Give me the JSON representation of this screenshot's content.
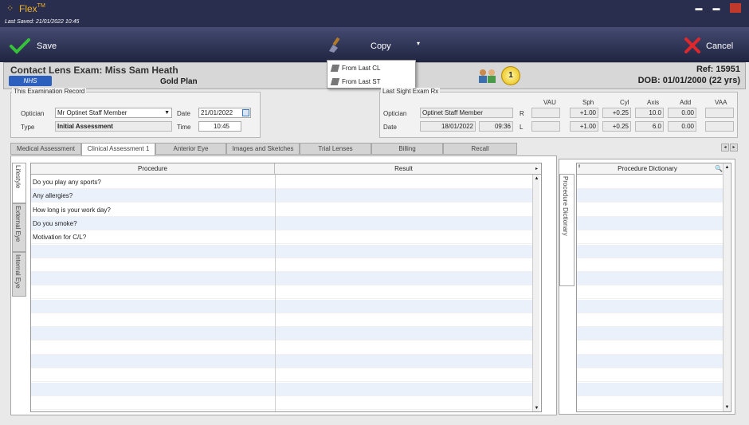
{
  "window": {
    "app_name": "Flex",
    "trademark": "TM",
    "minimize": "▬",
    "maximize": "▬"
  },
  "last_saved": "Last Saved: 21/01/2022 10:45",
  "toolbar": {
    "save_label": "Save",
    "copy_label": "Copy",
    "cancel_label": "Cancel",
    "copy_arrow": "▾"
  },
  "copy_menu": {
    "items": [
      "From Last CL",
      "From Last ST"
    ]
  },
  "patient": {
    "title": "Contact Lens Exam: Miss Sam Heath",
    "badge": "NHS",
    "plan": "Gold Plan",
    "ref": "Ref: 15951",
    "dob": "DOB: 01/01/2000 (22 yrs)",
    "count": "1"
  },
  "exam_record": {
    "legend": "This Examination Record",
    "optician_label": "Optician",
    "optician_value": "Mr Optinet Staff Member",
    "type_label": "Type",
    "type_value": "Initial Assessment",
    "date_label": "Date",
    "date_value": "21/01/2022",
    "time_label": "Time",
    "time_value": "10:45"
  },
  "last_sight": {
    "legend": "Last Sight Exam Rx",
    "optician_label": "Optician",
    "optician_value": "Optinet Staff Member",
    "date_label": "Date",
    "date_value": "18/01/2022",
    "time_value": "09:36",
    "columns": [
      "VAU",
      "Sph",
      "Cyl",
      "Axis",
      "Add",
      "VAA"
    ],
    "rows": [
      {
        "eye": "R",
        "vau": "",
        "sph": "+1.00",
        "cyl": "+0.25",
        "axis": "10.0",
        "add": "0.00",
        "vaa": ""
      },
      {
        "eye": "L",
        "vau": "",
        "sph": "+1.00",
        "cyl": "+0.25",
        "axis": "6.0",
        "add": "0.00",
        "vaa": ""
      }
    ]
  },
  "tabs": [
    "Medical Assessment",
    "Clinical Assessment 1",
    "Anterior Eye",
    "Images and Sketches",
    "Trial Lenses",
    "Billing",
    "Recall"
  ],
  "active_tab": "Clinical Assessment 1",
  "side_tabs": [
    "Lifestyle",
    "External Eye",
    "Internal Eye"
  ],
  "procedures": {
    "headers": [
      "Procedure",
      "Result"
    ],
    "rows": [
      "Do you play any sports?",
      "Any allergies?",
      "How long is your work day?",
      "Do you smoke?",
      "Motivation for C/L?"
    ]
  },
  "dictionary": {
    "tab_label": "Procedure Dictionary",
    "header": "Procedure Dictionary"
  }
}
